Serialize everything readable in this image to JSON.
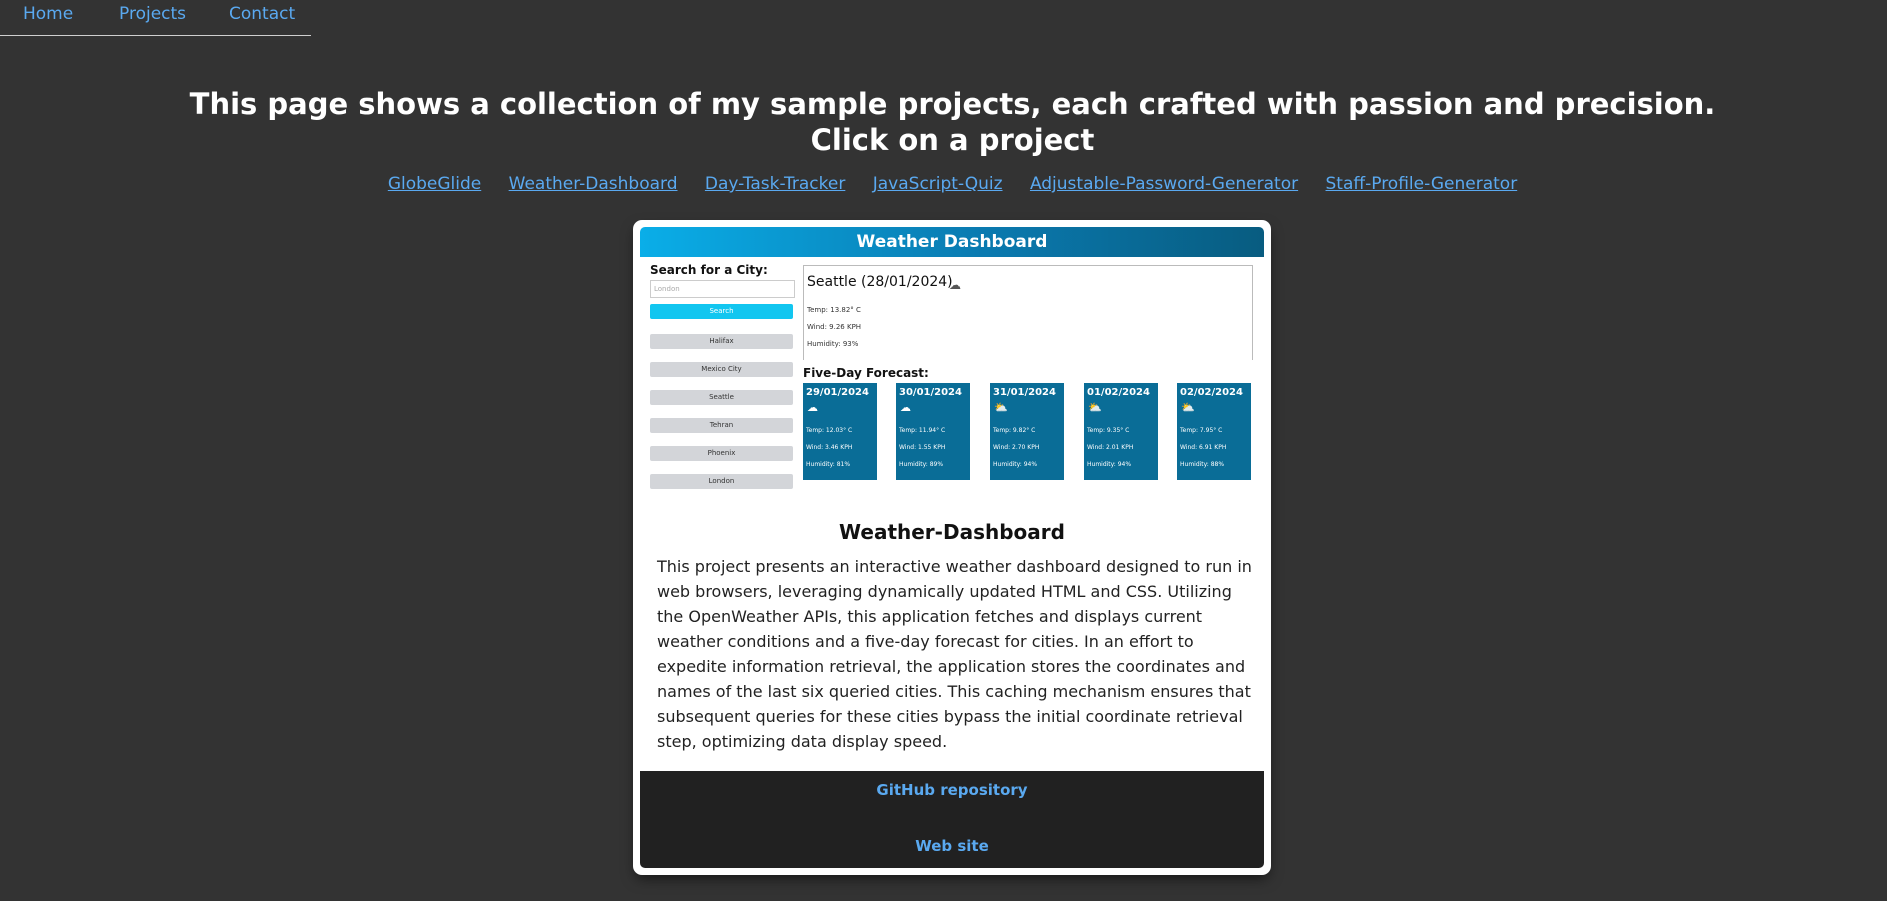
{
  "nav": {
    "items": [
      "Home",
      "Projects",
      "Contact"
    ]
  },
  "headline": {
    "line1": "This page shows a collection of my sample projects, each crafted with passion and precision.",
    "line2": "Click on a project"
  },
  "project_links": [
    "GlobeGlide",
    "Weather-Dashboard",
    "Day-Task-Tracker",
    "JavaScript-Quiz",
    "Adjustable-Password-Generator",
    "Staff-Profile-Generator"
  ],
  "card": {
    "screenshot": {
      "header": "Weather Dashboard",
      "search_label": "Search for a City:",
      "search_placeholder": "London",
      "search_button": "Search",
      "cities": [
        "Halifax",
        "Mexico City",
        "Seattle",
        "Tehran",
        "Phoenix",
        "London"
      ],
      "current": {
        "title": "Seattle (28/01/2024)",
        "temp": "Temp: 13.82° C",
        "wind": "Wind: 9.26 KPH",
        "humidity": "Humidity: 93%"
      },
      "forecast_label": "Five-Day Forecast:",
      "forecast": [
        {
          "date": "29/01/2024",
          "temp": "Temp: 12.03° C",
          "wind": "Wind: 3.46 KPH",
          "humidity": "Humidity: 81%"
        },
        {
          "date": "30/01/2024",
          "temp": "Temp: 11.94° C",
          "wind": "Wind: 1.55 KPH",
          "humidity": "Humidity: 89%"
        },
        {
          "date": "31/01/2024",
          "temp": "Temp: 9.82° C",
          "wind": "Wind: 2.70 KPH",
          "humidity": "Humidity: 94%"
        },
        {
          "date": "01/02/2024",
          "temp": "Temp: 9.35° C",
          "wind": "Wind: 2.01 KPH",
          "humidity": "Humidity: 94%"
        },
        {
          "date": "02/02/2024",
          "temp": "Temp: 7.95° C",
          "wind": "Wind: 6.91 KPH",
          "humidity": "Humidity: 88%"
        }
      ]
    },
    "title": "Weather-Dashboard",
    "description": "This project presents an interactive weather dashboard designed to run in web browsers, leveraging dynamically updated HTML and CSS. Utilizing the OpenWeather APIs, this application fetches and displays current weather conditions and a five-day forecast for cities. In an effort to expedite information retrieval, the application stores the coordinates and names of the last six queried cities. This caching mechanism ensures that subsequent queries for these cities bypass the initial coordinate retrieval step, optimizing data display speed.",
    "github_label": "GitHub repository",
    "website_label": "Web site"
  },
  "colors": {
    "background": "#333333",
    "link": "#5aa9f0",
    "footer": "#212121",
    "forecast_tile": "#0a6d97",
    "search_button": "#12c6f0"
  }
}
